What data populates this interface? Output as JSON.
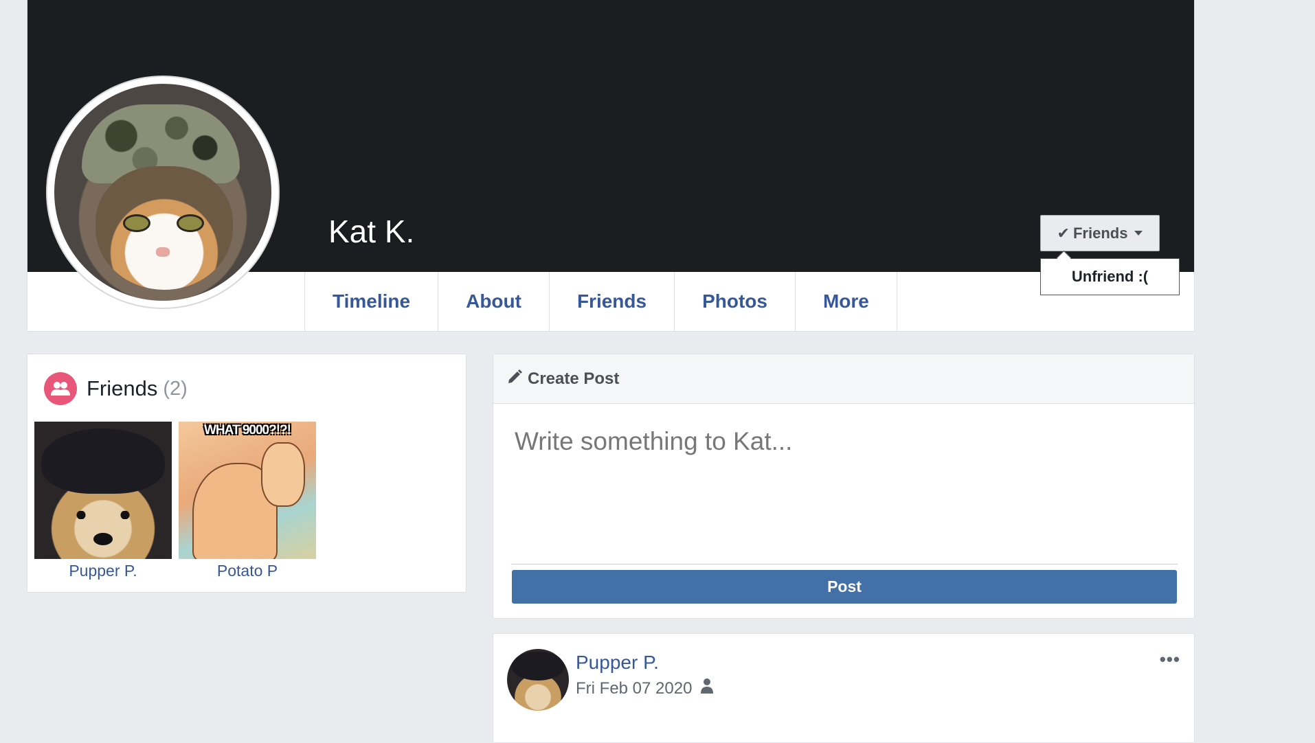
{
  "profile": {
    "name": "Kat K.",
    "friend_button_label": "Friends",
    "dropdown_item": "Unfriend :("
  },
  "tabs": [
    {
      "label": "Timeline"
    },
    {
      "label": "About"
    },
    {
      "label": "Friends"
    },
    {
      "label": "Photos"
    },
    {
      "label": "More"
    }
  ],
  "friends_panel": {
    "title": "Friends",
    "count": "(2)",
    "items": [
      {
        "name": "Pupper P."
      },
      {
        "name": "Potato P",
        "caption": "WHAT 9000?!?!"
      }
    ]
  },
  "create_post": {
    "header": "Create Post",
    "placeholder": "Write something to Kat...",
    "button_label": "Post"
  },
  "feed": {
    "post": {
      "author": "Pupper P.",
      "date": "Fri Feb 07 2020",
      "more_label": "•••"
    }
  },
  "colors": {
    "link": "#365899",
    "post_button": "#4370a6",
    "cover": "#1c1d20",
    "friends_icon": "#e8567a",
    "background": "#e9ebee"
  },
  "icons": {
    "friends_button": "check-icon",
    "friends_panel": "friends-icon",
    "create_post": "pencil-icon",
    "audience": "person-icon"
  }
}
